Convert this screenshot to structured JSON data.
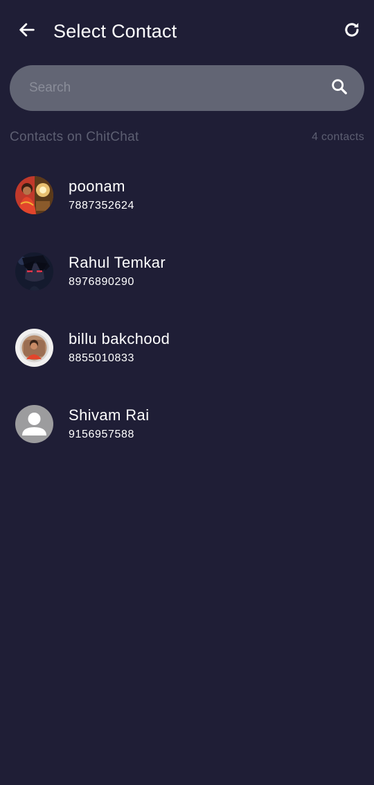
{
  "header": {
    "title": "Select Contact",
    "back_icon": "arrow-left-icon",
    "refresh_icon": "refresh-icon"
  },
  "search": {
    "placeholder": "Search",
    "value": "",
    "icon": "search-icon"
  },
  "section": {
    "label": "Contacts on ChitChat",
    "count": "4 contacts"
  },
  "contacts": [
    {
      "name": "poonam",
      "phone": "7887352624",
      "avatar": "photo-avatar"
    },
    {
      "name": "Rahul Temkar",
      "phone": "8976890290",
      "avatar": "anime-avatar"
    },
    {
      "name": "billu bakchood",
      "phone": "8855010833",
      "avatar": "photo-avatar"
    },
    {
      "name": "Shivam Rai",
      "phone": "9156957588",
      "avatar": "default-person-icon"
    }
  ],
  "colors": {
    "background": "#1f1e36",
    "search_bar": "#626574",
    "muted_text": "#5d5f72",
    "primary_text": "#ffffff"
  }
}
